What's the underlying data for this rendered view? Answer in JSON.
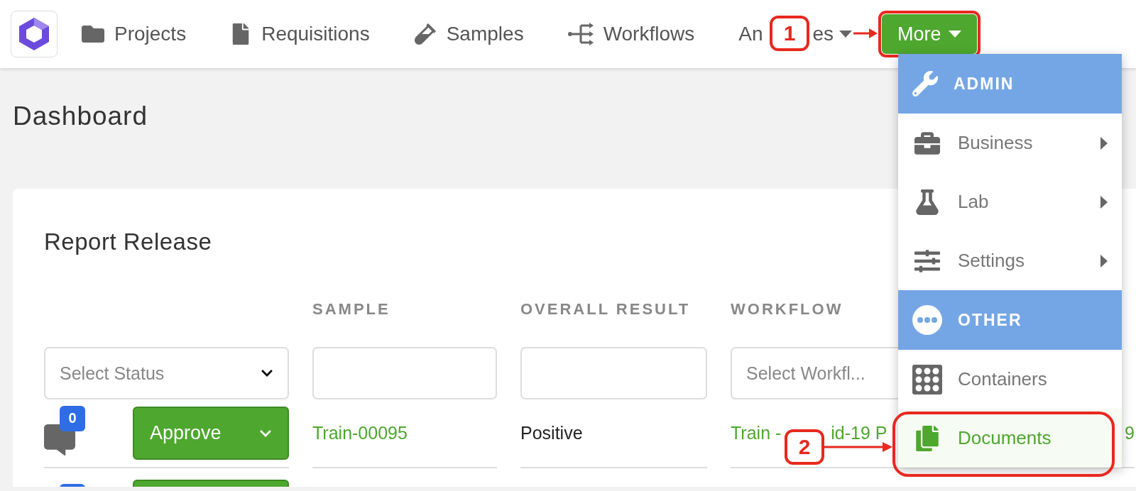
{
  "nav": {
    "items": [
      {
        "label": "Projects"
      },
      {
        "label": "Requisitions"
      },
      {
        "label": "Samples"
      },
      {
        "label": "Workflows"
      },
      {
        "label_parts": [
          "An",
          "es"
        ]
      }
    ],
    "more": {
      "label": "More",
      "expanded": true
    }
  },
  "menu": [
    {
      "kind": "header",
      "label": "ADMIN"
    },
    {
      "kind": "item",
      "label": "Business",
      "submenu": true,
      "selected": false
    },
    {
      "kind": "item",
      "label": "Lab",
      "submenu": true,
      "selected": false
    },
    {
      "kind": "item",
      "label": "Settings",
      "submenu": true,
      "selected": false
    },
    {
      "kind": "header",
      "label": "OTHER"
    },
    {
      "kind": "item",
      "label": "Containers",
      "submenu": false,
      "selected": false
    },
    {
      "kind": "item",
      "label": "Documents",
      "submenu": false,
      "selected": true
    }
  ],
  "page_title": "Dashboard",
  "card": {
    "title": "Report Release",
    "columns": [
      "SAMPLE",
      "OVERALL RESULT",
      "WORKFLOW"
    ],
    "filters": {
      "status_placeholder": "Select Status",
      "workflow_placeholder": "Select Workfl..."
    },
    "rows": [
      {
        "comments": "0",
        "action": "Approve",
        "sample": "Train-00095",
        "result": "Positive",
        "workflow_parts": [
          "Train -",
          "id-19 P"
        ],
        "column_4": "9"
      }
    ]
  },
  "callouts": [
    {
      "number": "1"
    },
    {
      "number": "2"
    }
  ]
}
